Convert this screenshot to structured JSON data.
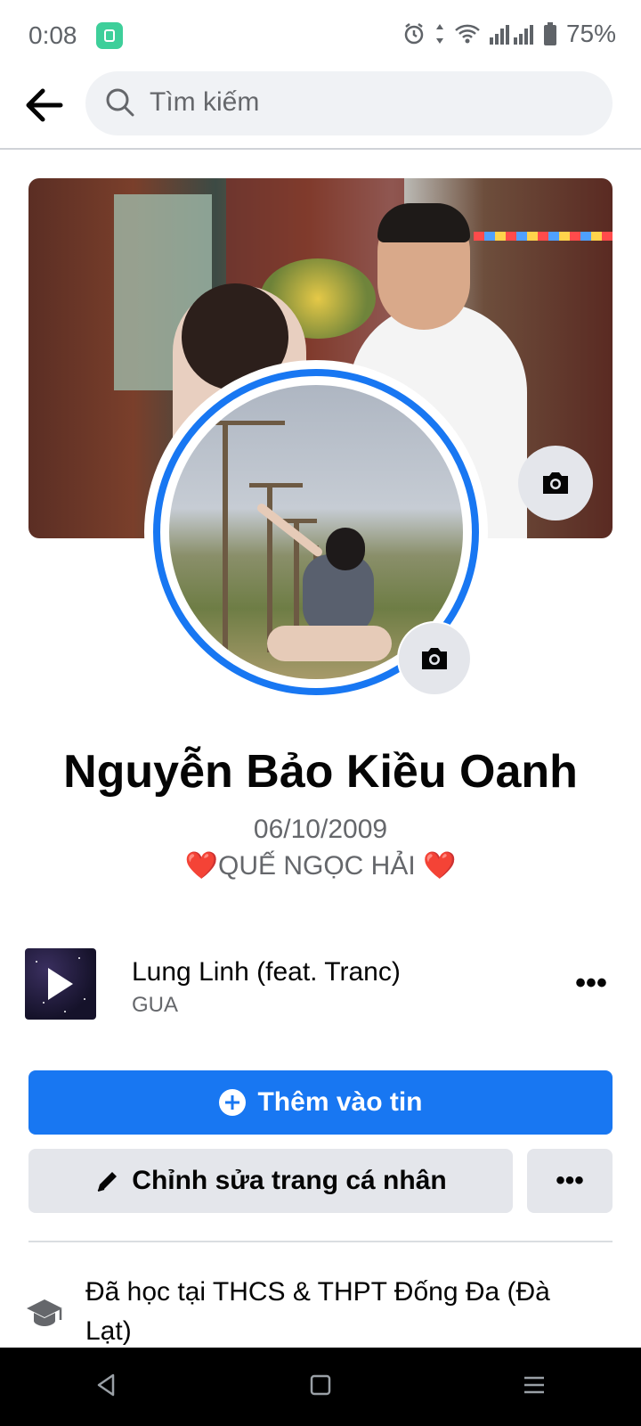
{
  "status": {
    "time": "0:08",
    "battery": "75%"
  },
  "search": {
    "placeholder": "Tìm kiếm"
  },
  "profile": {
    "name": "Nguyễn Bảo Kiều Oanh",
    "dob": "06/10/2009",
    "bio": "❤️QUẾ NGỌC HẢI ❤️"
  },
  "music": {
    "title": "Lung Linh (feat. Tranc)",
    "artist": "GUA",
    "more": "•••"
  },
  "actions": {
    "add_story": "Thêm vào tin",
    "edit_profile": "Chỉnh sửa trang cá nhân",
    "more": "•••"
  },
  "about": {
    "education": "Đã học tại THCS & THPT Đống Đa (Đà Lạt)"
  },
  "colors": {
    "accent": "#1877f2",
    "button_gray": "#e4e6eb",
    "secondary_text": "#65676b"
  }
}
